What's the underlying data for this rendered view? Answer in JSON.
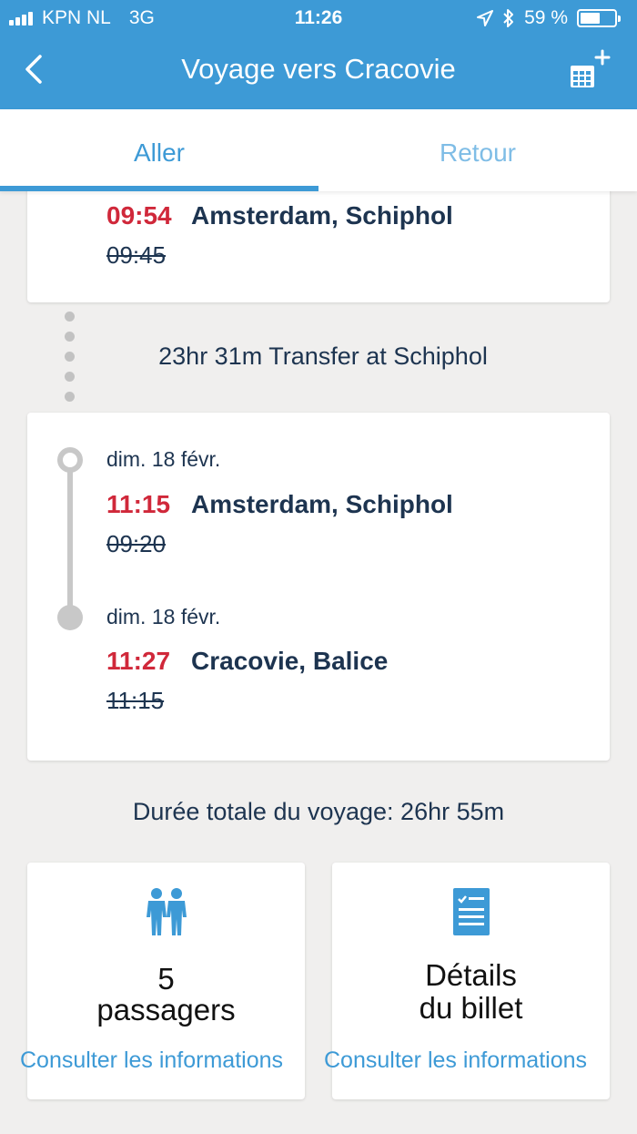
{
  "status_bar": {
    "carrier": "KPN NL",
    "network": "3G",
    "time": "11:26",
    "battery_pct": "59 %",
    "battery_level": 0.59
  },
  "header": {
    "title": "Voyage vers Cracovie",
    "back_icon": "chevron-left-icon",
    "calendar_icon": "calendar-add-icon"
  },
  "tabs": {
    "aller": "Aller",
    "retour": "Retour",
    "active": "aller"
  },
  "segment1": {
    "arrival_time": "09:54",
    "arrival_place": "Amsterdam, Schiphol",
    "scheduled_time": "09:45"
  },
  "transfer": {
    "text": "23hr 31m Transfer at Schiphol"
  },
  "segment2": {
    "departure_date": "dim. 18 févr.",
    "departure_time": "11:15",
    "departure_place": "Amsterdam, Schiphol",
    "departure_scheduled": "09:20",
    "arrival_date": "dim. 18 févr.",
    "arrival_time": "11:27",
    "arrival_place": "Cracovie, Balice",
    "arrival_scheduled": "11:15"
  },
  "total_duration": "Durée totale du voyage: 26hr 55m",
  "passengers": {
    "count": "5",
    "label": "passagers",
    "link": "Consulter les informations",
    "icon": "passengers-icon"
  },
  "ticket": {
    "line1": "Détails",
    "line2": "du billet",
    "link": "Consulter les informations",
    "icon": "ticket-details-icon"
  },
  "colors": {
    "brand_blue": "#3d9ad6",
    "delay_red": "#d0283a",
    "text_navy": "#1d3450"
  }
}
